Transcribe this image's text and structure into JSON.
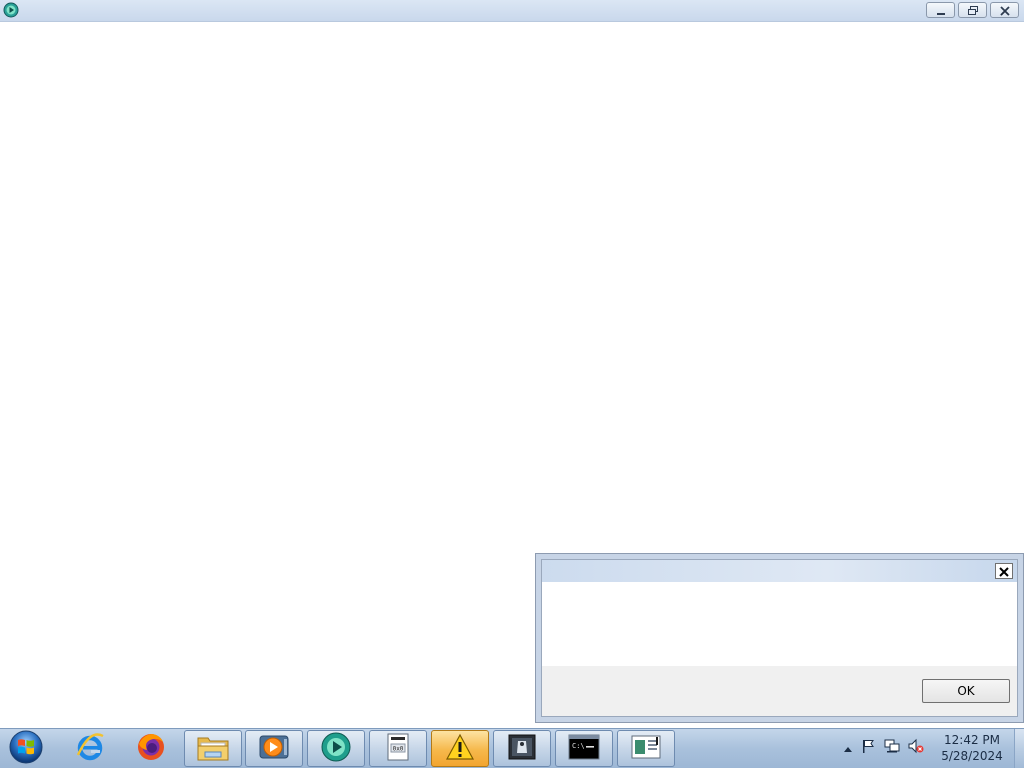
{
  "window": {
    "title": "",
    "icon": "media-player-icon",
    "caption_buttons": [
      "minimize",
      "restore",
      "close"
    ]
  },
  "dialog": {
    "title": "",
    "message": "",
    "close_icon": "close-icon",
    "ok_label": "OK"
  },
  "taskbar": {
    "start": "windows-start-orb",
    "items": [
      {
        "name": "internet-explorer",
        "icon": "internet-explorer-icon",
        "state": "pinned"
      },
      {
        "name": "firefox",
        "icon": "firefox-icon",
        "state": "pinned"
      },
      {
        "name": "file-explorer",
        "icon": "folder-icon",
        "state": "running"
      },
      {
        "name": "media-player",
        "icon": "media-player-icon",
        "state": "running"
      },
      {
        "name": "media-app",
        "icon": "media-app-icon",
        "state": "running"
      },
      {
        "name": "notepad-document",
        "icon": "document-icon",
        "state": "running"
      },
      {
        "name": "warning-app",
        "icon": "warning-icon",
        "state": "active"
      },
      {
        "name": "process-monitor",
        "icon": "process-monitor-icon",
        "state": "running"
      },
      {
        "name": "command-prompt",
        "icon": "command-prompt-icon",
        "state": "running"
      },
      {
        "name": "window-app",
        "icon": "window-icon",
        "state": "running"
      }
    ],
    "tray": {
      "icons": [
        "show-hidden-icons-arrow",
        "action-center-flag-icon",
        "network-icon",
        "volume-muted-icon"
      ],
      "time": "12:42 PM",
      "date": "5/28/2024"
    }
  }
}
